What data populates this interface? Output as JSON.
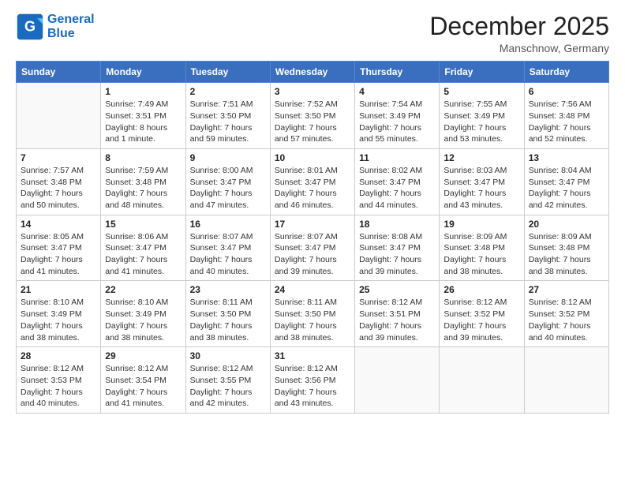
{
  "header": {
    "logo_line1": "General",
    "logo_line2": "Blue",
    "title": "December 2025",
    "subtitle": "Manschnow, Germany"
  },
  "weekdays": [
    "Sunday",
    "Monday",
    "Tuesday",
    "Wednesday",
    "Thursday",
    "Friday",
    "Saturday"
  ],
  "weeks": [
    [
      {
        "day": null
      },
      {
        "day": "1",
        "sunrise": "Sunrise: 7:49 AM",
        "sunset": "Sunset: 3:51 PM",
        "daylight": "Daylight: 8 hours and 1 minute."
      },
      {
        "day": "2",
        "sunrise": "Sunrise: 7:51 AM",
        "sunset": "Sunset: 3:50 PM",
        "daylight": "Daylight: 7 hours and 59 minutes."
      },
      {
        "day": "3",
        "sunrise": "Sunrise: 7:52 AM",
        "sunset": "Sunset: 3:50 PM",
        "daylight": "Daylight: 7 hours and 57 minutes."
      },
      {
        "day": "4",
        "sunrise": "Sunrise: 7:54 AM",
        "sunset": "Sunset: 3:49 PM",
        "daylight": "Daylight: 7 hours and 55 minutes."
      },
      {
        "day": "5",
        "sunrise": "Sunrise: 7:55 AM",
        "sunset": "Sunset: 3:49 PM",
        "daylight": "Daylight: 7 hours and 53 minutes."
      },
      {
        "day": "6",
        "sunrise": "Sunrise: 7:56 AM",
        "sunset": "Sunset: 3:48 PM",
        "daylight": "Daylight: 7 hours and 52 minutes."
      }
    ],
    [
      {
        "day": "7",
        "sunrise": "Sunrise: 7:57 AM",
        "sunset": "Sunset: 3:48 PM",
        "daylight": "Daylight: 7 hours and 50 minutes."
      },
      {
        "day": "8",
        "sunrise": "Sunrise: 7:59 AM",
        "sunset": "Sunset: 3:48 PM",
        "daylight": "Daylight: 7 hours and 48 minutes."
      },
      {
        "day": "9",
        "sunrise": "Sunrise: 8:00 AM",
        "sunset": "Sunset: 3:47 PM",
        "daylight": "Daylight: 7 hours and 47 minutes."
      },
      {
        "day": "10",
        "sunrise": "Sunrise: 8:01 AM",
        "sunset": "Sunset: 3:47 PM",
        "daylight": "Daylight: 7 hours and 46 minutes."
      },
      {
        "day": "11",
        "sunrise": "Sunrise: 8:02 AM",
        "sunset": "Sunset: 3:47 PM",
        "daylight": "Daylight: 7 hours and 44 minutes."
      },
      {
        "day": "12",
        "sunrise": "Sunrise: 8:03 AM",
        "sunset": "Sunset: 3:47 PM",
        "daylight": "Daylight: 7 hours and 43 minutes."
      },
      {
        "day": "13",
        "sunrise": "Sunrise: 8:04 AM",
        "sunset": "Sunset: 3:47 PM",
        "daylight": "Daylight: 7 hours and 42 minutes."
      }
    ],
    [
      {
        "day": "14",
        "sunrise": "Sunrise: 8:05 AM",
        "sunset": "Sunset: 3:47 PM",
        "daylight": "Daylight: 7 hours and 41 minutes."
      },
      {
        "day": "15",
        "sunrise": "Sunrise: 8:06 AM",
        "sunset": "Sunset: 3:47 PM",
        "daylight": "Daylight: 7 hours and 41 minutes."
      },
      {
        "day": "16",
        "sunrise": "Sunrise: 8:07 AM",
        "sunset": "Sunset: 3:47 PM",
        "daylight": "Daylight: 7 hours and 40 minutes."
      },
      {
        "day": "17",
        "sunrise": "Sunrise: 8:07 AM",
        "sunset": "Sunset: 3:47 PM",
        "daylight": "Daylight: 7 hours and 39 minutes."
      },
      {
        "day": "18",
        "sunrise": "Sunrise: 8:08 AM",
        "sunset": "Sunset: 3:47 PM",
        "daylight": "Daylight: 7 hours and 39 minutes."
      },
      {
        "day": "19",
        "sunrise": "Sunrise: 8:09 AM",
        "sunset": "Sunset: 3:48 PM",
        "daylight": "Daylight: 7 hours and 38 minutes."
      },
      {
        "day": "20",
        "sunrise": "Sunrise: 8:09 AM",
        "sunset": "Sunset: 3:48 PM",
        "daylight": "Daylight: 7 hours and 38 minutes."
      }
    ],
    [
      {
        "day": "21",
        "sunrise": "Sunrise: 8:10 AM",
        "sunset": "Sunset: 3:49 PM",
        "daylight": "Daylight: 7 hours and 38 minutes."
      },
      {
        "day": "22",
        "sunrise": "Sunrise: 8:10 AM",
        "sunset": "Sunset: 3:49 PM",
        "daylight": "Daylight: 7 hours and 38 minutes."
      },
      {
        "day": "23",
        "sunrise": "Sunrise: 8:11 AM",
        "sunset": "Sunset: 3:50 PM",
        "daylight": "Daylight: 7 hours and 38 minutes."
      },
      {
        "day": "24",
        "sunrise": "Sunrise: 8:11 AM",
        "sunset": "Sunset: 3:50 PM",
        "daylight": "Daylight: 7 hours and 38 minutes."
      },
      {
        "day": "25",
        "sunrise": "Sunrise: 8:12 AM",
        "sunset": "Sunset: 3:51 PM",
        "daylight": "Daylight: 7 hours and 39 minutes."
      },
      {
        "day": "26",
        "sunrise": "Sunrise: 8:12 AM",
        "sunset": "Sunset: 3:52 PM",
        "daylight": "Daylight: 7 hours and 39 minutes."
      },
      {
        "day": "27",
        "sunrise": "Sunrise: 8:12 AM",
        "sunset": "Sunset: 3:52 PM",
        "daylight": "Daylight: 7 hours and 40 minutes."
      }
    ],
    [
      {
        "day": "28",
        "sunrise": "Sunrise: 8:12 AM",
        "sunset": "Sunset: 3:53 PM",
        "daylight": "Daylight: 7 hours and 40 minutes."
      },
      {
        "day": "29",
        "sunrise": "Sunrise: 8:12 AM",
        "sunset": "Sunset: 3:54 PM",
        "daylight": "Daylight: 7 hours and 41 minutes."
      },
      {
        "day": "30",
        "sunrise": "Sunrise: 8:12 AM",
        "sunset": "Sunset: 3:55 PM",
        "daylight": "Daylight: 7 hours and 42 minutes."
      },
      {
        "day": "31",
        "sunrise": "Sunrise: 8:12 AM",
        "sunset": "Sunset: 3:56 PM",
        "daylight": "Daylight: 7 hours and 43 minutes."
      },
      {
        "day": null
      },
      {
        "day": null
      },
      {
        "day": null
      }
    ]
  ]
}
